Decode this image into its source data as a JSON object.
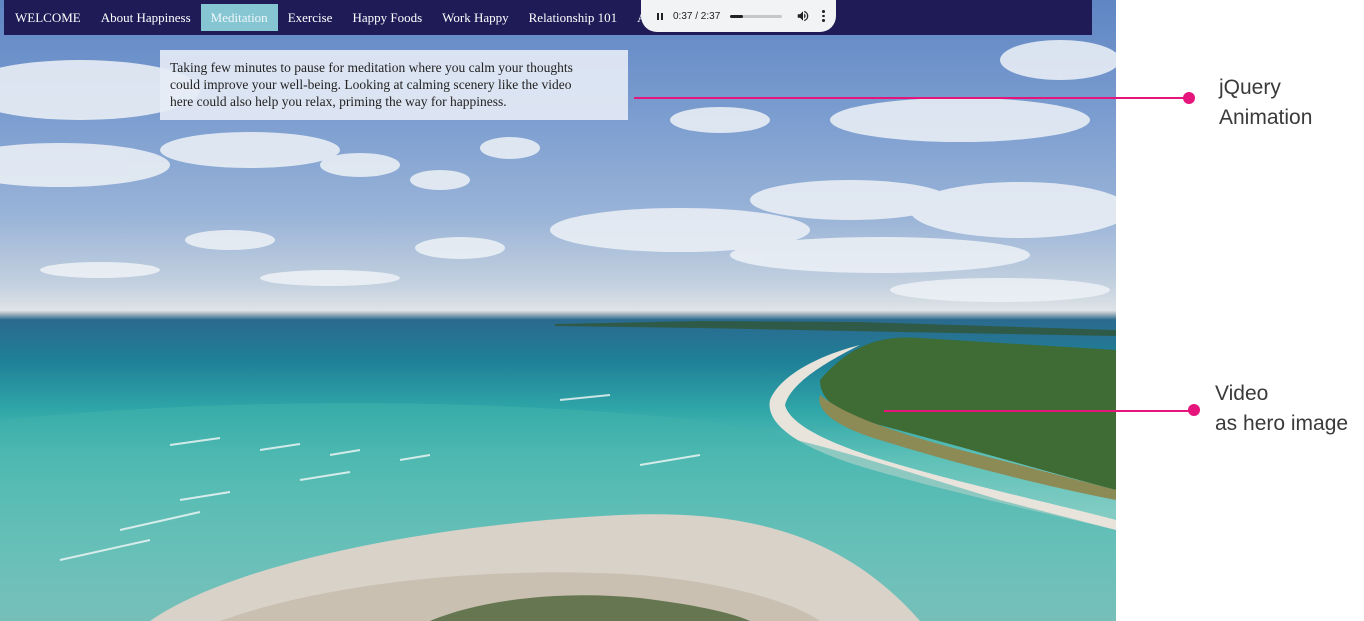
{
  "nav": {
    "items": [
      {
        "label": "WELCOME"
      },
      {
        "label": "About Happiness"
      },
      {
        "label": "Meditation"
      },
      {
        "label": "Exercise"
      },
      {
        "label": "Happy Foods"
      },
      {
        "label": "Work Happy"
      },
      {
        "label": "Relationship 101"
      },
      {
        "label": "Activities"
      }
    ],
    "active_label": "Meditation"
  },
  "player": {
    "time": "0:37 / 2:37",
    "progress": 0.236,
    "state": "playing",
    "icons": [
      "pause-icon",
      "volume-icon",
      "more-options-icon"
    ]
  },
  "caption": {
    "line1": "Taking few minutes to pause for meditation where you calm your thoughts",
    "line2": "could improve your well-being. Looking at calming scenery like the video",
    "line3": "here could also help you relax, priming the way for happiness."
  },
  "annotations": {
    "jquery": {
      "line1": "jQuery",
      "line2": "Animation"
    },
    "video": {
      "line1": "Video",
      "line2": "as hero image"
    },
    "accent_color": "#e5157b"
  },
  "colors": {
    "nav_background": "#1f1b57",
    "nav_active": "#86c6d3",
    "player_background": "#f1f3f4"
  }
}
